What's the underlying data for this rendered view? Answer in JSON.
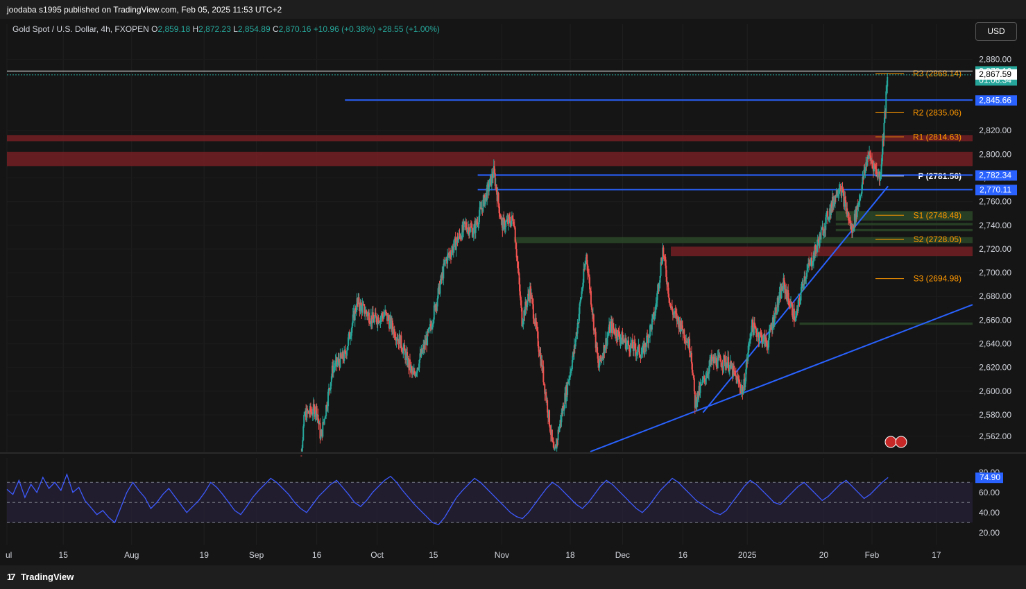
{
  "header": {
    "publish_info": "joodaba s1995 published on TradingView.com, Feb 05, 2025 11:53 UTC+2"
  },
  "legend": {
    "symbol": "Gold Spot / U.S. Dollar, 4h, FXOPEN",
    "o_label": "O",
    "o_value": "2,859.18",
    "h_label": "H",
    "h_value": "2,872.23",
    "l_label": "L",
    "l_value": "2,854.89",
    "c_label": "C",
    "c_value": "2,870.16",
    "change": "+10.96 (+0.38%)",
    "change2": "+28.55 (+1.00%)"
  },
  "currency_button": "USD",
  "footer": {
    "brand": "TradingView"
  },
  "colors": {
    "up": "#26a69a",
    "down": "#ef5350",
    "line": "#2962ff",
    "pivot": "#ff9800",
    "red_zone": "#7a1f24",
    "green_zone": "#2e4d2a",
    "rsi": "#3d5afe",
    "rsi_band": "#2a2340"
  },
  "chart_data": [
    {
      "type": "candlestick",
      "title": "Gold Spot / U.S. Dollar, 4h, FXOPEN",
      "x_tick_labels": [
        "ul",
        "15",
        "Aug",
        "19",
        "Sep",
        "16",
        "Oct",
        "15",
        "Nov",
        "18",
        "Dec",
        "16",
        "2025",
        "20",
        "Feb",
        "17"
      ],
      "y_tick_labels": [
        "2,562.00",
        "2,580.00",
        "2,600.00",
        "2,620.00",
        "2,640.00",
        "2,660.00",
        "2,680.00",
        "2,700.00",
        "2,720.00",
        "2,740.00",
        "2,760.00",
        "2,780.00",
        "2,800.00",
        "2,820.00",
        "2,880.00"
      ],
      "ylim": [
        2549,
        2895
      ],
      "price_path": [
        {
          "x": "Sep 11",
          "y": 2510
        },
        {
          "x": "Sep 13",
          "y": 2580
        },
        {
          "x": "Sep 16",
          "y": 2585
        },
        {
          "x": "Sep 17",
          "y": 2560
        },
        {
          "x": "Sep 20",
          "y": 2620
        },
        {
          "x": "Sep 23",
          "y": 2630
        },
        {
          "x": "Sep 26",
          "y": 2675
        },
        {
          "x": "Sep 30",
          "y": 2660
        },
        {
          "x": "Oct 3",
          "y": 2665
        },
        {
          "x": "Oct 7",
          "y": 2640
        },
        {
          "x": "Oct 10",
          "y": 2612
        },
        {
          "x": "Oct 14",
          "y": 2650
        },
        {
          "x": "Oct 18",
          "y": 2710
        },
        {
          "x": "Oct 23",
          "y": 2740
        },
        {
          "x": "Oct 25",
          "y": 2735
        },
        {
          "x": "Oct 30",
          "y": 2785
        },
        {
          "x": "Nov 1",
          "y": 2740
        },
        {
          "x": "Nov 4",
          "y": 2745
        },
        {
          "x": "Nov 6",
          "y": 2660
        },
        {
          "x": "Nov 8",
          "y": 2685
        },
        {
          "x": "Nov 11",
          "y": 2620
        },
        {
          "x": "Nov 14",
          "y": 2545
        },
        {
          "x": "Nov 15",
          "y": 2565
        },
        {
          "x": "Nov 19",
          "y": 2635
        },
        {
          "x": "Nov 22",
          "y": 2715
        },
        {
          "x": "Nov 25",
          "y": 2620
        },
        {
          "x": "Nov 28",
          "y": 2655
        },
        {
          "x": "Dec 2",
          "y": 2640
        },
        {
          "x": "Dec 6",
          "y": 2632
        },
        {
          "x": "Dec 9",
          "y": 2665
        },
        {
          "x": "Dec 11",
          "y": 2720
        },
        {
          "x": "Dec 13",
          "y": 2670
        },
        {
          "x": "Dec 16",
          "y": 2652
        },
        {
          "x": "Dec 18",
          "y": 2635
        },
        {
          "x": "Dec 19",
          "y": 2590
        },
        {
          "x": "Dec 23",
          "y": 2625
        },
        {
          "x": "Dec 27",
          "y": 2625
        },
        {
          "x": "Dec 31",
          "y": 2600
        },
        {
          "x": "Jan 2",
          "y": 2655
        },
        {
          "x": "Jan 6",
          "y": 2640
        },
        {
          "x": "Jan 8",
          "y": 2668
        },
        {
          "x": "Jan 10",
          "y": 2690
        },
        {
          "x": "Jan 13",
          "y": 2660
        },
        {
          "x": "Jan 15",
          "y": 2695
        },
        {
          "x": "Jan 17",
          "y": 2710
        },
        {
          "x": "Jan 21",
          "y": 2748
        },
        {
          "x": "Jan 24",
          "y": 2775
        },
        {
          "x": "Jan 27",
          "y": 2735
        },
        {
          "x": "Jan 29",
          "y": 2765
        },
        {
          "x": "Jan 31",
          "y": 2800
        },
        {
          "x": "Feb 3",
          "y": 2780
        },
        {
          "x": "Feb 5",
          "y": 2870
        }
      ],
      "horizontal_lines": [
        {
          "label": "R3 (2868.14)",
          "value": 2868.14,
          "color": "pivot"
        },
        {
          "label": "R2 (2835.06)",
          "value": 2835.06,
          "color": "pivot"
        },
        {
          "label": "R1 (2814.63)",
          "value": 2814.63,
          "color": "pivot"
        },
        {
          "label": "P (2781.56)",
          "value": 2781.56,
          "color": "white"
        },
        {
          "label": "S1 (2748.48)",
          "value": 2748.48,
          "color": "pivot"
        },
        {
          "label": "S2 (2728.05)",
          "value": 2728.05,
          "color": "pivot"
        },
        {
          "label": "S3 (2694.98)",
          "value": 2694.98,
          "color": "pivot"
        }
      ],
      "trend_lines": [
        {
          "value": 2845.66
        },
        {
          "value": 2782.34
        },
        {
          "value": 2770.11
        }
      ],
      "zones": [
        {
          "kind": "resistance",
          "from": 2811,
          "to": 2816
        },
        {
          "kind": "resistance",
          "from": 2790,
          "to": 2802
        },
        {
          "kind": "resistance",
          "from": 2714,
          "to": 2722
        },
        {
          "kind": "support",
          "from": 2744,
          "to": 2752
        },
        {
          "kind": "support",
          "from": 2725,
          "to": 2730
        },
        {
          "kind": "support",
          "from": 2740,
          "to": 2742
        },
        {
          "kind": "support",
          "from": 2735,
          "to": 2737
        },
        {
          "kind": "support",
          "from": 2656,
          "to": 2658
        }
      ],
      "price_labels": [
        {
          "text": "2,870.16",
          "sub": "01:06:34",
          "value": 2870.16,
          "style": "up"
        },
        {
          "text": "2,867.59",
          "value": 2867.59,
          "style": "light"
        },
        {
          "text": "2,845.66",
          "value": 2845.66,
          "style": "blue"
        },
        {
          "text": "2,782.34",
          "value": 2782.34,
          "style": "blue"
        },
        {
          "text": "2,770.11",
          "value": 2770.11,
          "style": "blue"
        }
      ]
    },
    {
      "type": "line",
      "title": "",
      "y_tick_labels": [
        "80.00",
        "60.00",
        "40.00",
        "20.00"
      ],
      "ylim": [
        15,
        84
      ],
      "levels": [
        70,
        50,
        30
      ],
      "last_value_label": "74.90",
      "series": [
        {
          "values": [
            63,
            58,
            72,
            55,
            68,
            60,
            75,
            64,
            70,
            62,
            78,
            60,
            65,
            52,
            45,
            38,
            42,
            35,
            30,
            45,
            60,
            70,
            62,
            55,
            44,
            50,
            58,
            64,
            56,
            48,
            40,
            46,
            52,
            60,
            70,
            65,
            58,
            50,
            42,
            38,
            46,
            55,
            62,
            68,
            74,
            70,
            64,
            58,
            50,
            44,
            40,
            48,
            56,
            62,
            68,
            72,
            65,
            58,
            50,
            46,
            52,
            60,
            66,
            72,
            76,
            70,
            62,
            55,
            48,
            42,
            36,
            30,
            28,
            35,
            45,
            55,
            62,
            68,
            74,
            70,
            64,
            58,
            52,
            46,
            40,
            36,
            34,
            40,
            48,
            56,
            64,
            70,
            66,
            60,
            54,
            48,
            44,
            50,
            58,
            66,
            72,
            68,
            62,
            56,
            50,
            44,
            40,
            46,
            54,
            62,
            68,
            74,
            70,
            64,
            58,
            52,
            48,
            44,
            40,
            38,
            42,
            50,
            58,
            66,
            72,
            68,
            62,
            56,
            50,
            48,
            54,
            60,
            66,
            70,
            64,
            58,
            52,
            56,
            62,
            68,
            72,
            66,
            60,
            54,
            58,
            64,
            70,
            74.9
          ]
        }
      ]
    }
  ]
}
